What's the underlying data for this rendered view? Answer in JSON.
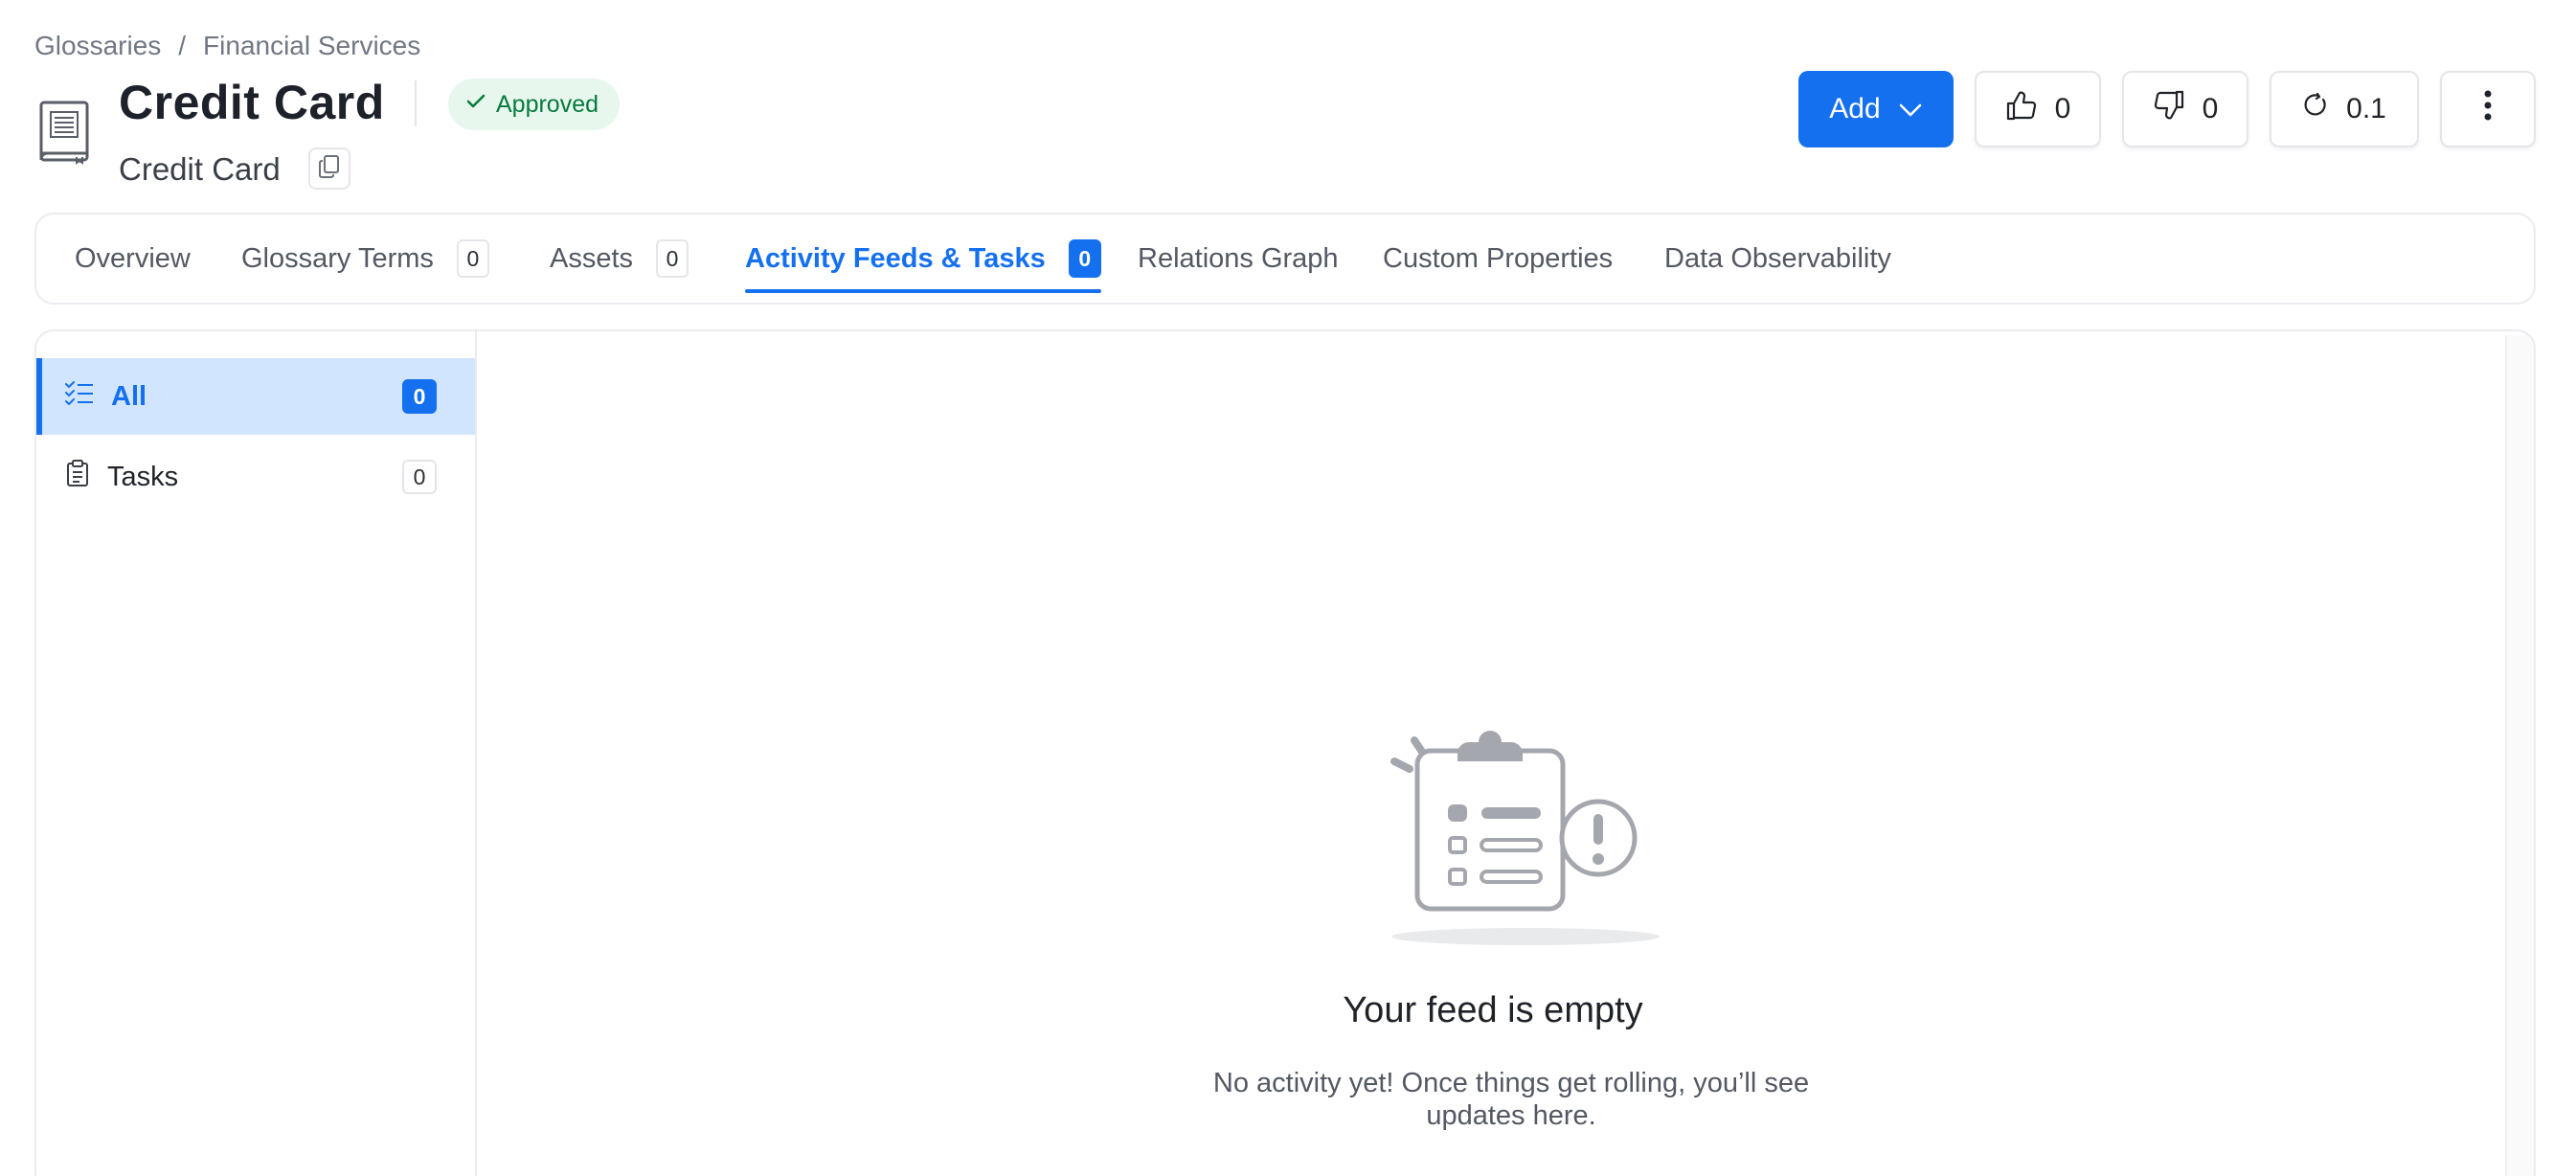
{
  "breadcrumb": {
    "items": [
      "Glossaries",
      "Financial Services"
    ],
    "separator": "/"
  },
  "header": {
    "title": "Credit Card",
    "display_name": "Credit Card",
    "status": "Approved",
    "icon": "glossary-book-icon"
  },
  "actions": {
    "add_label": "Add",
    "likes": "0",
    "dislikes": "0",
    "version": "0.1"
  },
  "tabs": [
    {
      "label": "Overview",
      "count": null
    },
    {
      "label": "Glossary Terms",
      "count": "0"
    },
    {
      "label": "Assets",
      "count": "0"
    },
    {
      "label": "Activity Feeds & Tasks",
      "count": "0",
      "active": true
    },
    {
      "label": "Relations Graph",
      "count": null
    },
    {
      "label": "Custom Properties",
      "count": null
    },
    {
      "label": "Data Observability",
      "count": null
    }
  ],
  "feed_filters": [
    {
      "label": "All",
      "count": "0",
      "active": true,
      "icon": "checklist-icon"
    },
    {
      "label": "Tasks",
      "count": "0",
      "icon": "clipboard-icon"
    }
  ],
  "empty_state": {
    "title": "Your feed is empty",
    "description": "No activity yet! Once things get rolling, you’ll see updates here."
  },
  "colors": {
    "accent": "#1570ef",
    "approved_bg": "#e8f7ee",
    "approved_text": "#067a3c",
    "active_row_bg": "#d1e5fe"
  }
}
